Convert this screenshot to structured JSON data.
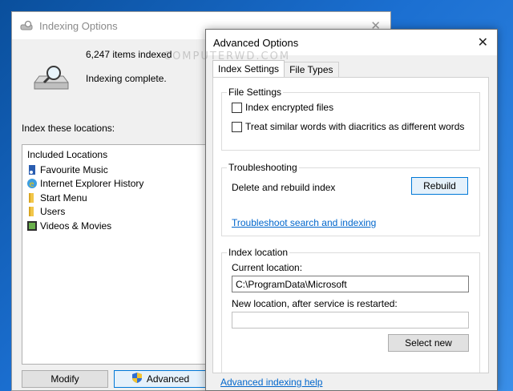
{
  "indexing_window": {
    "title": "Indexing Options",
    "items_indexed": "6,247 items indexed",
    "status": "Indexing complete.",
    "locations_label": "Index these locations:",
    "list_header": "Included Locations",
    "locations": [
      {
        "label": "Favourite Music",
        "icon": "music-folder-icon"
      },
      {
        "label": "Internet Explorer History",
        "icon": "ie-icon"
      },
      {
        "label": "Start Menu",
        "icon": "folder-icon"
      },
      {
        "label": "Users",
        "icon": "folder-icon"
      },
      {
        "label": "Videos & Movies",
        "icon": "video-folder-icon"
      }
    ],
    "modify_label": "Modify",
    "advanced_label": "Advanced"
  },
  "advanced_window": {
    "title": "Advanced Options",
    "tabs": [
      {
        "label": "Index Settings",
        "active": true
      },
      {
        "label": "File Types",
        "active": false
      }
    ],
    "file_settings": {
      "title": "File Settings",
      "encrypt_label": "Index encrypted files",
      "diacritics_label": "Treat similar words with diacritics as different words"
    },
    "troubleshooting": {
      "title": "Troubleshooting",
      "delete_text": "Delete and rebuild index",
      "rebuild_label": "Rebuild",
      "troubleshoot_link": "Troubleshoot search and indexing"
    },
    "index_location": {
      "title": "Index location",
      "current_label": "Current location:",
      "current_value": "C:\\ProgramData\\Microsoft",
      "new_label": "New location, after service is restarted:",
      "new_value": "",
      "select_new_label": "Select new"
    },
    "help_link": "Advanced indexing help"
  },
  "watermark": "COMPUTERWD.COM",
  "colors": {
    "accent": "#0078d7",
    "link": "#0066cc",
    "desktop": "#1b6fd1"
  }
}
